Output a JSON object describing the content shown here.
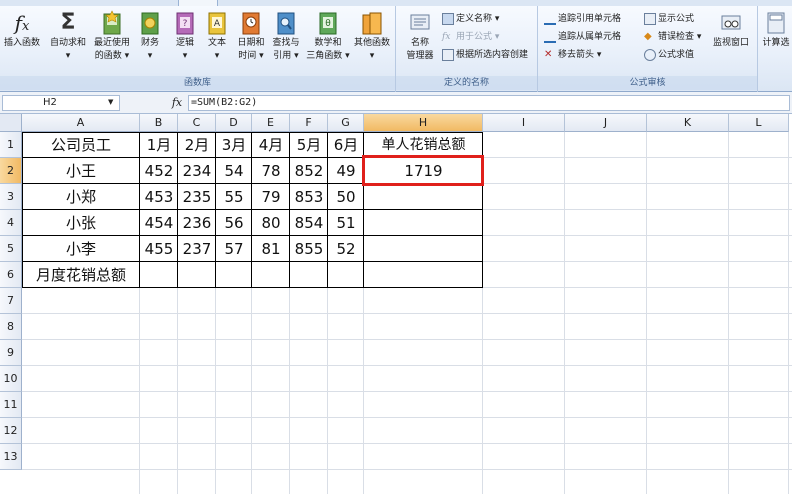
{
  "ribbon": {
    "groups": {
      "function_library": "函数库",
      "defined_names": "定义的名称",
      "formula_auditing": "公式审核"
    },
    "buttons": {
      "insert_function": "插入函数",
      "autosum": "自动求和",
      "recent_1": "最近使用",
      "recent_2": "的函数",
      "financial": "财务",
      "logical": "逻辑",
      "text": "文本",
      "datetime_1": "日期和",
      "datetime_2": "时间",
      "lookup_1": "查找与",
      "lookup_2": "引用",
      "math_1": "数学和",
      "math_2": "三角函数",
      "more": "其他函数",
      "name_manager_1": "名称",
      "name_manager_2": "管理器",
      "define_name": "定义名称",
      "use_in_formula": "用于公式",
      "create_from_selection": "根据所选内容创建",
      "trace_precedents": "追踪引用单元格",
      "trace_dependents": "追踪从属单元格",
      "remove_arrows": "移去箭头",
      "show_formulas": "显示公式",
      "error_checking": "错误检查",
      "evaluate_formula": "公式求值",
      "watch_window": "监视窗口",
      "calculate": "计算选"
    }
  },
  "formula_bar": {
    "name_box": "H2",
    "fx": "fx",
    "formula": "=SUM(B2:G2)"
  },
  "sheet": {
    "columns": [
      "A",
      "B",
      "C",
      "D",
      "E",
      "F",
      "G",
      "H",
      "I",
      "J",
      "K",
      "L"
    ],
    "rows": [
      "1",
      "2",
      "3",
      "4",
      "5",
      "6",
      "7",
      "8",
      "9",
      "10",
      "11",
      "12",
      "13"
    ],
    "selected_cell": "H2",
    "cells": {
      "r1": [
        "公司员工",
        "1月",
        "2月",
        "3月",
        "4月",
        "5月",
        "6月",
        "单人花销总额"
      ],
      "r2": [
        "小王",
        "452",
        "234",
        "54",
        "78",
        "852",
        "49",
        "1719"
      ],
      "r3": [
        "小郑",
        "453",
        "235",
        "55",
        "79",
        "853",
        "50",
        ""
      ],
      "r4": [
        "小张",
        "454",
        "236",
        "56",
        "80",
        "854",
        "51",
        ""
      ],
      "r5": [
        "小李",
        "455",
        "237",
        "57",
        "81",
        "855",
        "52",
        ""
      ],
      "r6": [
        "月度花销总额",
        "",
        "",
        "",
        "",
        "",
        "",
        ""
      ]
    }
  },
  "colors": {
    "selection_highlight": "#e0201b",
    "header_selected": "#f1b963"
  }
}
